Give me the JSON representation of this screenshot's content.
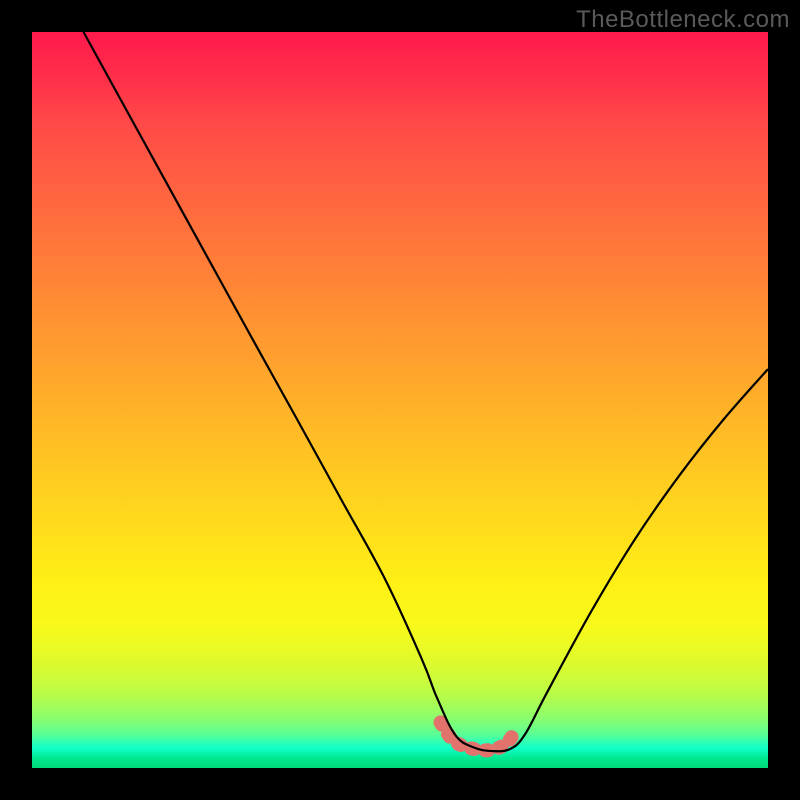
{
  "watermark": "TheBottleneck.com",
  "chart_data": {
    "type": "line",
    "title": "",
    "xlabel": "",
    "ylabel": "",
    "xlim": [
      0,
      100
    ],
    "ylim": [
      0,
      100
    ],
    "grid": false,
    "series": [
      {
        "name": "bottleneck-curve",
        "x": [
          7,
          12,
          18,
          24,
          30,
          36,
          42,
          48,
          53,
          55,
          57.5,
          60,
          62.5,
          65,
          67,
          70,
          76,
          82,
          88,
          94,
          100
        ],
        "y": [
          100,
          90.9,
          80,
          69.1,
          58.2,
          47.4,
          36.5,
          25.6,
          14.7,
          9.6,
          4.5,
          2.8,
          2.3,
          2.6,
          4.6,
          10.3,
          21.3,
          31.2,
          39.8,
          47.4,
          54.2
        ]
      },
      {
        "name": "highlight-band",
        "x": [
          55.5,
          57,
          58.5,
          60,
          61.5,
          63,
          64.5,
          66
        ],
        "y": [
          6.2,
          4.0,
          3.0,
          2.6,
          2.4,
          2.6,
          3.4,
          5.4
        ]
      }
    ],
    "colors": {
      "curve": "#000000",
      "highlight": "#e2736c",
      "gradient_top": "#ff1a4c",
      "gradient_bottom": "#00d97a"
    }
  }
}
